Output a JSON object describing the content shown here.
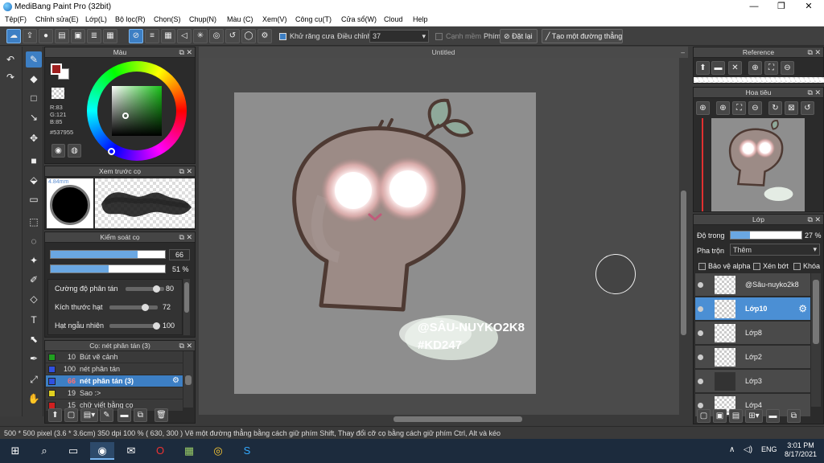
{
  "window": {
    "title": "MediBang Paint Pro (32bit)",
    "minimize": "—",
    "maximize": "❐",
    "close": "✕"
  },
  "menu": [
    "Tệp(F)",
    "Chỉnh sửa(E)",
    "Lớp(L)",
    "Bộ lọc(R)",
    "Chọn(S)",
    "Chụp(N)",
    "Màu (C)",
    "Xem(V)",
    "Công cụ(T)",
    "Cửa sổ(W)",
    "Cloud",
    "Help"
  ],
  "toolbar": {
    "antialias_label": "Khử răng cưa",
    "adjust_label": "Điều chỉnh",
    "adjust_value": "37",
    "smooth_label": "Cạnh mềm",
    "key_label": "Phím",
    "reset_label": "Đặt lại",
    "straight_line_label": "Tạo một đường thẳng"
  },
  "color_panel": {
    "title": "Màu",
    "r": "R:83",
    "g": "G:121",
    "b": "B:85",
    "hex": "#537955",
    "primary_color": "#a02020",
    "secondary_color": "#ffffff"
  },
  "brush_preview": {
    "title": "Xem trước cọ",
    "size_label": "4.84mm"
  },
  "brush_control": {
    "title": "Kiểm soát cọ",
    "size_value": "66",
    "size_fraction": 0.76,
    "opacity_value": "51 %",
    "opacity_fraction": 0.51,
    "params": [
      {
        "label": "Cường độ phân tán",
        "value": "80",
        "fraction": 0.8
      },
      {
        "label": "Kích thước hạt",
        "value": "72",
        "fraction": 0.72
      },
      {
        "label": "Hạt ngẫu nhiên",
        "value": "100",
        "fraction": 1.0
      }
    ]
  },
  "brush_list": {
    "title": "Cọ: nét phân tán (3)",
    "items": [
      {
        "num": "10",
        "name": "Bút vẽ cảnh",
        "color": "#20a020"
      },
      {
        "num": "100",
        "name": "nét phân tán",
        "color": "#3050e0"
      },
      {
        "num": "66",
        "name": "nét phân tán (3)",
        "color": "#3050e0",
        "selected": true
      },
      {
        "num": "19",
        "name": "Sao :>",
        "color": "#e0d020"
      },
      {
        "num": "15",
        "name": "chữ viết bằng cọ",
        "color": "#d02020"
      }
    ]
  },
  "document": {
    "tab_title": "Untitled",
    "watermark_line1": "@SÂU-NUYKO2K8",
    "watermark_line2": "#KD247"
  },
  "reference_panel": {
    "title": "Reference"
  },
  "navigator_panel": {
    "title": "Hoa tiêu"
  },
  "layers_panel": {
    "title": "Lớp",
    "opacity_label": "Độ trong",
    "opacity_value": "27 %",
    "opacity_fraction": 0.27,
    "blend_label": "Pha trộn",
    "blend_value": "Thêm",
    "protect_alpha": "Bảo vệ alpha",
    "clipping": "Xén bớt",
    "lock": "Khóa",
    "layers": [
      {
        "name": "@Sâu-nuyko2k8",
        "selected": false
      },
      {
        "name": "Lớp10",
        "selected": true
      },
      {
        "name": "Lớp8",
        "selected": false
      },
      {
        "name": "Lớp2",
        "selected": false
      },
      {
        "name": "Lớp3",
        "selected": false
      },
      {
        "name": "Lớp4",
        "selected": false
      }
    ]
  },
  "status": {
    "text": "500 * 500 pixel   (3.6 * 3.6cm)   350 dpi   100 %   ( 630, 300 )   Vẽ một đường thẳng bằng cách giữ phím Shift, Thay đổi cỡ cọ bằng cách giữ phím Ctrl, Alt và kéo"
  },
  "taskbar": {
    "lang": "ENG",
    "time": "3:01 PM",
    "date": "8/17/2021"
  }
}
